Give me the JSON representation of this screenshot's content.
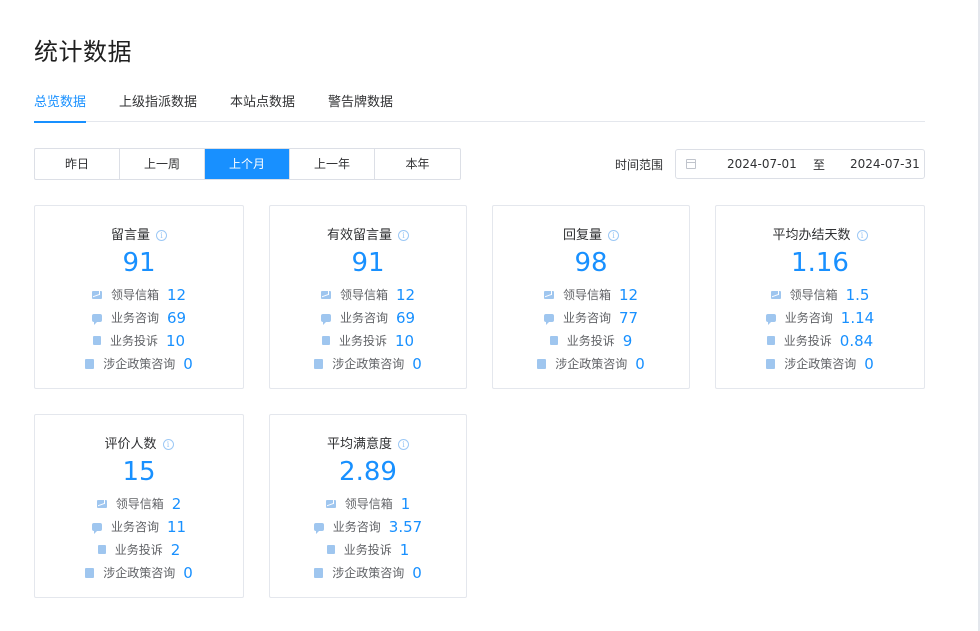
{
  "page": {
    "title": "统计数据"
  },
  "tabs": [
    {
      "label": "总览数据",
      "active": true
    },
    {
      "label": "上级指派数据",
      "active": false
    },
    {
      "label": "本站点数据",
      "active": false
    },
    {
      "label": "警告牌数据",
      "active": false
    }
  ],
  "range": {
    "options": [
      "昨日",
      "上一周",
      "上个月",
      "上一年",
      "本年"
    ],
    "selected": "上个月"
  },
  "date_range": {
    "label": "时间范围",
    "start": "2024-07-01",
    "separator": "至",
    "end": "2024-07-31"
  },
  "metric_labels": {
    "mailbox": "领导信箱",
    "consult": "业务咨询",
    "complaint": "业务投诉",
    "policy": "涉企政策咨询"
  },
  "colors": {
    "accent": "#1890ff",
    "icon": "#9fc6ef"
  },
  "cards": [
    {
      "title": "留言量",
      "value": "91",
      "mailbox": "12",
      "consult": "69",
      "complaint": "10",
      "policy": "0"
    },
    {
      "title": "有效留言量",
      "value": "91",
      "mailbox": "12",
      "consult": "69",
      "complaint": "10",
      "policy": "0"
    },
    {
      "title": "回复量",
      "value": "98",
      "mailbox": "12",
      "consult": "77",
      "complaint": "9",
      "policy": "0"
    },
    {
      "title": "平均办结天数",
      "value": "1.16",
      "mailbox": "1.5",
      "consult": "1.14",
      "complaint": "0.84",
      "policy": "0"
    },
    {
      "title": "评价人数",
      "value": "15",
      "mailbox": "2",
      "consult": "11",
      "complaint": "2",
      "policy": "0"
    },
    {
      "title": "平均满意度",
      "value": "2.89",
      "mailbox": "1",
      "consult": "3.57",
      "complaint": "1",
      "policy": "0"
    }
  ]
}
